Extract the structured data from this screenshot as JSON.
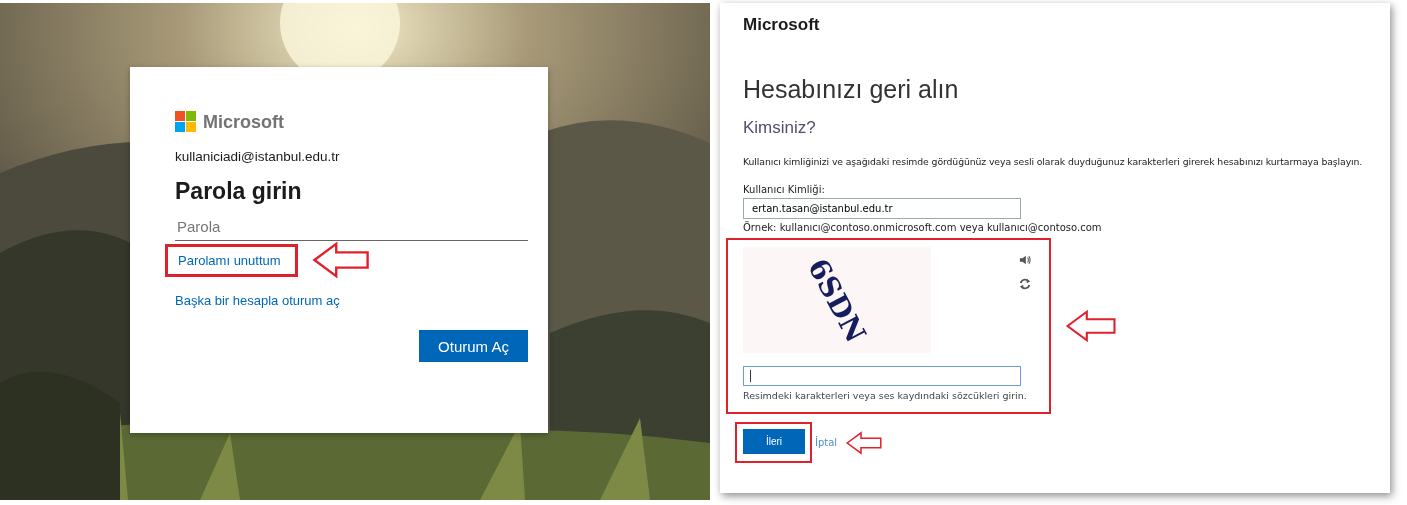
{
  "login_card": {
    "logo_text": "Microsoft",
    "account": "kullaniciadi@istanbul.edu.tr",
    "title": "Parola girin",
    "password_field": {
      "placeholder": "Parola"
    },
    "links": [
      {
        "text": "Parolamı unuttum",
        "highlighted": true
      },
      {
        "text": "Başka bir hesapla oturum aç",
        "highlighted": false
      }
    ],
    "button": "Oturum Aç"
  },
  "recovery_page": {
    "logo_text": "Microsoft",
    "title": "Hesabınızı geri alın",
    "subtitle": "Kimsiniz?",
    "instructions": "Kullanıcı kimliğinizi ve aşağıdaki resimde gördüğünüz veya sesli olarak duyduğunuz karakterleri girerek hesabınızı kurtarmaya başlayın.",
    "user_id": {
      "label": "Kullanıcı Kimliği:",
      "value": "ertan.tasan@istanbul.edu.tr",
      "example": "Örnek: kullanıcı@contoso.onmicrosoft.com veya kullanıcı@contoso.com"
    },
    "captcha": {
      "characters": "6SDN",
      "hint": "Resimdeki karakterleri veya ses kaydındaki sözcükleri girin.",
      "highlighted": true
    },
    "buttons": [
      {
        "label": "İleri",
        "kind": "primary",
        "highlighted": true
      },
      {
        "label": "İptal",
        "kind": "link",
        "highlighted": false
      }
    ]
  }
}
